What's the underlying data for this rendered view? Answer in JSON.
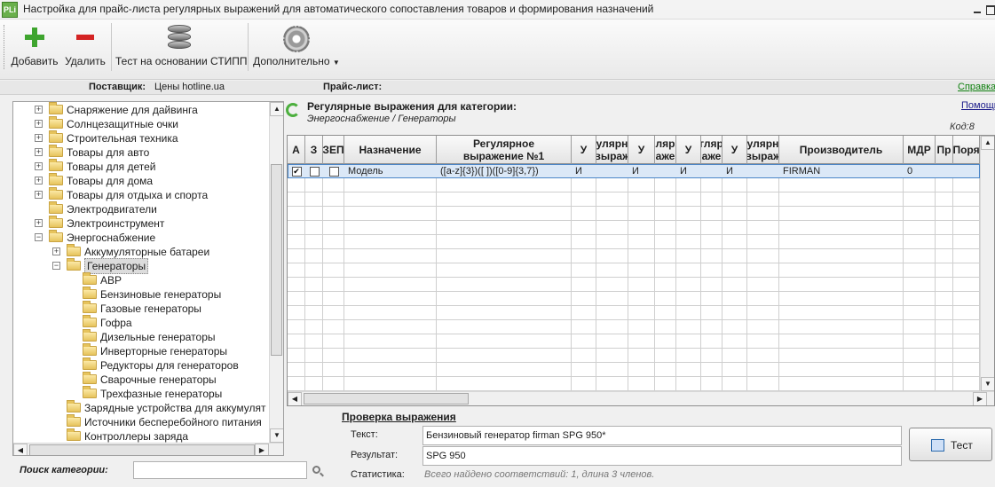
{
  "window": {
    "app_icon": "PLi",
    "title": "Настройка для прайс-листа регулярных выражений для автоматического сопоставления товаров и формирования назначений"
  },
  "toolbar": {
    "add_label": "Добавить",
    "delete_label": "Удалить",
    "test_label": "Тест на основании СТИПП",
    "more_label": "Дополнительно",
    "add_icon": "plus-icon",
    "delete_icon": "minus-icon",
    "test_icon": "database-icon",
    "more_icon": "gear-icon"
  },
  "info": {
    "supplier_label": "Поставщик:",
    "supplier_value": "Цены hotline.ua",
    "pricelist_label": "Прайс-лист:",
    "help_link": "Справка"
  },
  "tree": {
    "items": [
      {
        "label": "Снаряжение для дайвинга",
        "level": 1,
        "expander": "+"
      },
      {
        "label": "Солнцезащитные очки",
        "level": 1,
        "expander": "+"
      },
      {
        "label": "Строительная техника",
        "level": 1,
        "expander": "+"
      },
      {
        "label": "Товары для авто",
        "level": 1,
        "expander": "+"
      },
      {
        "label": "Товары для детей",
        "level": 1,
        "expander": "+"
      },
      {
        "label": "Товары для дома",
        "level": 1,
        "expander": "+"
      },
      {
        "label": "Товары для отдыха и спорта",
        "level": 1,
        "expander": "+"
      },
      {
        "label": "Электродвигатели",
        "level": 1,
        "expander": ""
      },
      {
        "label": "Электроинструмент",
        "level": 1,
        "expander": "+"
      },
      {
        "label": "Энергоснабжение",
        "level": 1,
        "expander": "−"
      },
      {
        "label": "Аккумуляторные батареи",
        "level": 2,
        "expander": "+"
      },
      {
        "label": "Генераторы",
        "level": 2,
        "expander": "−",
        "selected": true
      },
      {
        "label": "АВР",
        "level": 3,
        "expander": ""
      },
      {
        "label": "Бензиновые генераторы",
        "level": 3,
        "expander": ""
      },
      {
        "label": "Газовые генераторы",
        "level": 3,
        "expander": ""
      },
      {
        "label": "Гофра",
        "level": 3,
        "expander": ""
      },
      {
        "label": "Дизельные генераторы",
        "level": 3,
        "expander": ""
      },
      {
        "label": "Инверторные генераторы",
        "level": 3,
        "expander": ""
      },
      {
        "label": "Редукторы для генераторов",
        "level": 3,
        "expander": ""
      },
      {
        "label": "Сварочные генераторы",
        "level": 3,
        "expander": ""
      },
      {
        "label": "Трехфазные генераторы",
        "level": 3,
        "expander": ""
      },
      {
        "label": "Зарядные устройства для аккумулят",
        "level": 2,
        "expander": ""
      },
      {
        "label": "Источники бесперебойного питания",
        "level": 2,
        "expander": ""
      },
      {
        "label": "Контроллеры заряда",
        "level": 2,
        "expander": ""
      }
    ]
  },
  "search": {
    "label": "Поиск категории:",
    "value": "",
    "icon": "search-icon"
  },
  "regex_panel": {
    "title": "Регулярные выражения для категории:",
    "category_path": "Энергоснабжение / Генераторы",
    "help_link": "Помощь",
    "code_label": "Код:8",
    "refresh_icon": "refresh-icon"
  },
  "grid": {
    "columns": [
      "А",
      "З",
      "ЗЕП",
      "Назначение",
      "Регулярное\nвыражение №1",
      "У",
      "улярн\nвыраж",
      "У",
      "ляр\nаже",
      "У",
      "гляр\nаже",
      "У",
      "улярн\nвыраж",
      "Производитель",
      "МДР",
      "Пр",
      "Поря"
    ],
    "rows": [
      {
        "a": true,
        "z": false,
        "zep": false,
        "cells": [
          "Модель",
          "([a-z]{3})([ ])([0-9]{3,7})",
          "И",
          "",
          "И",
          "",
          "И",
          "",
          "И",
          "",
          "FIRMAN",
          "0",
          "",
          ""
        ]
      }
    ]
  },
  "test": {
    "title": "Проверка выражения",
    "text_label": "Текст:",
    "text_value": "Бензиновый генератор firman SPG 950*",
    "result_label": "Результат:",
    "result_value": "SPG 950",
    "stats_label": "Статистика:",
    "stats_value": "Всего найдено соответствий: 1, длина 3 членов.",
    "button_label": "Тест"
  }
}
